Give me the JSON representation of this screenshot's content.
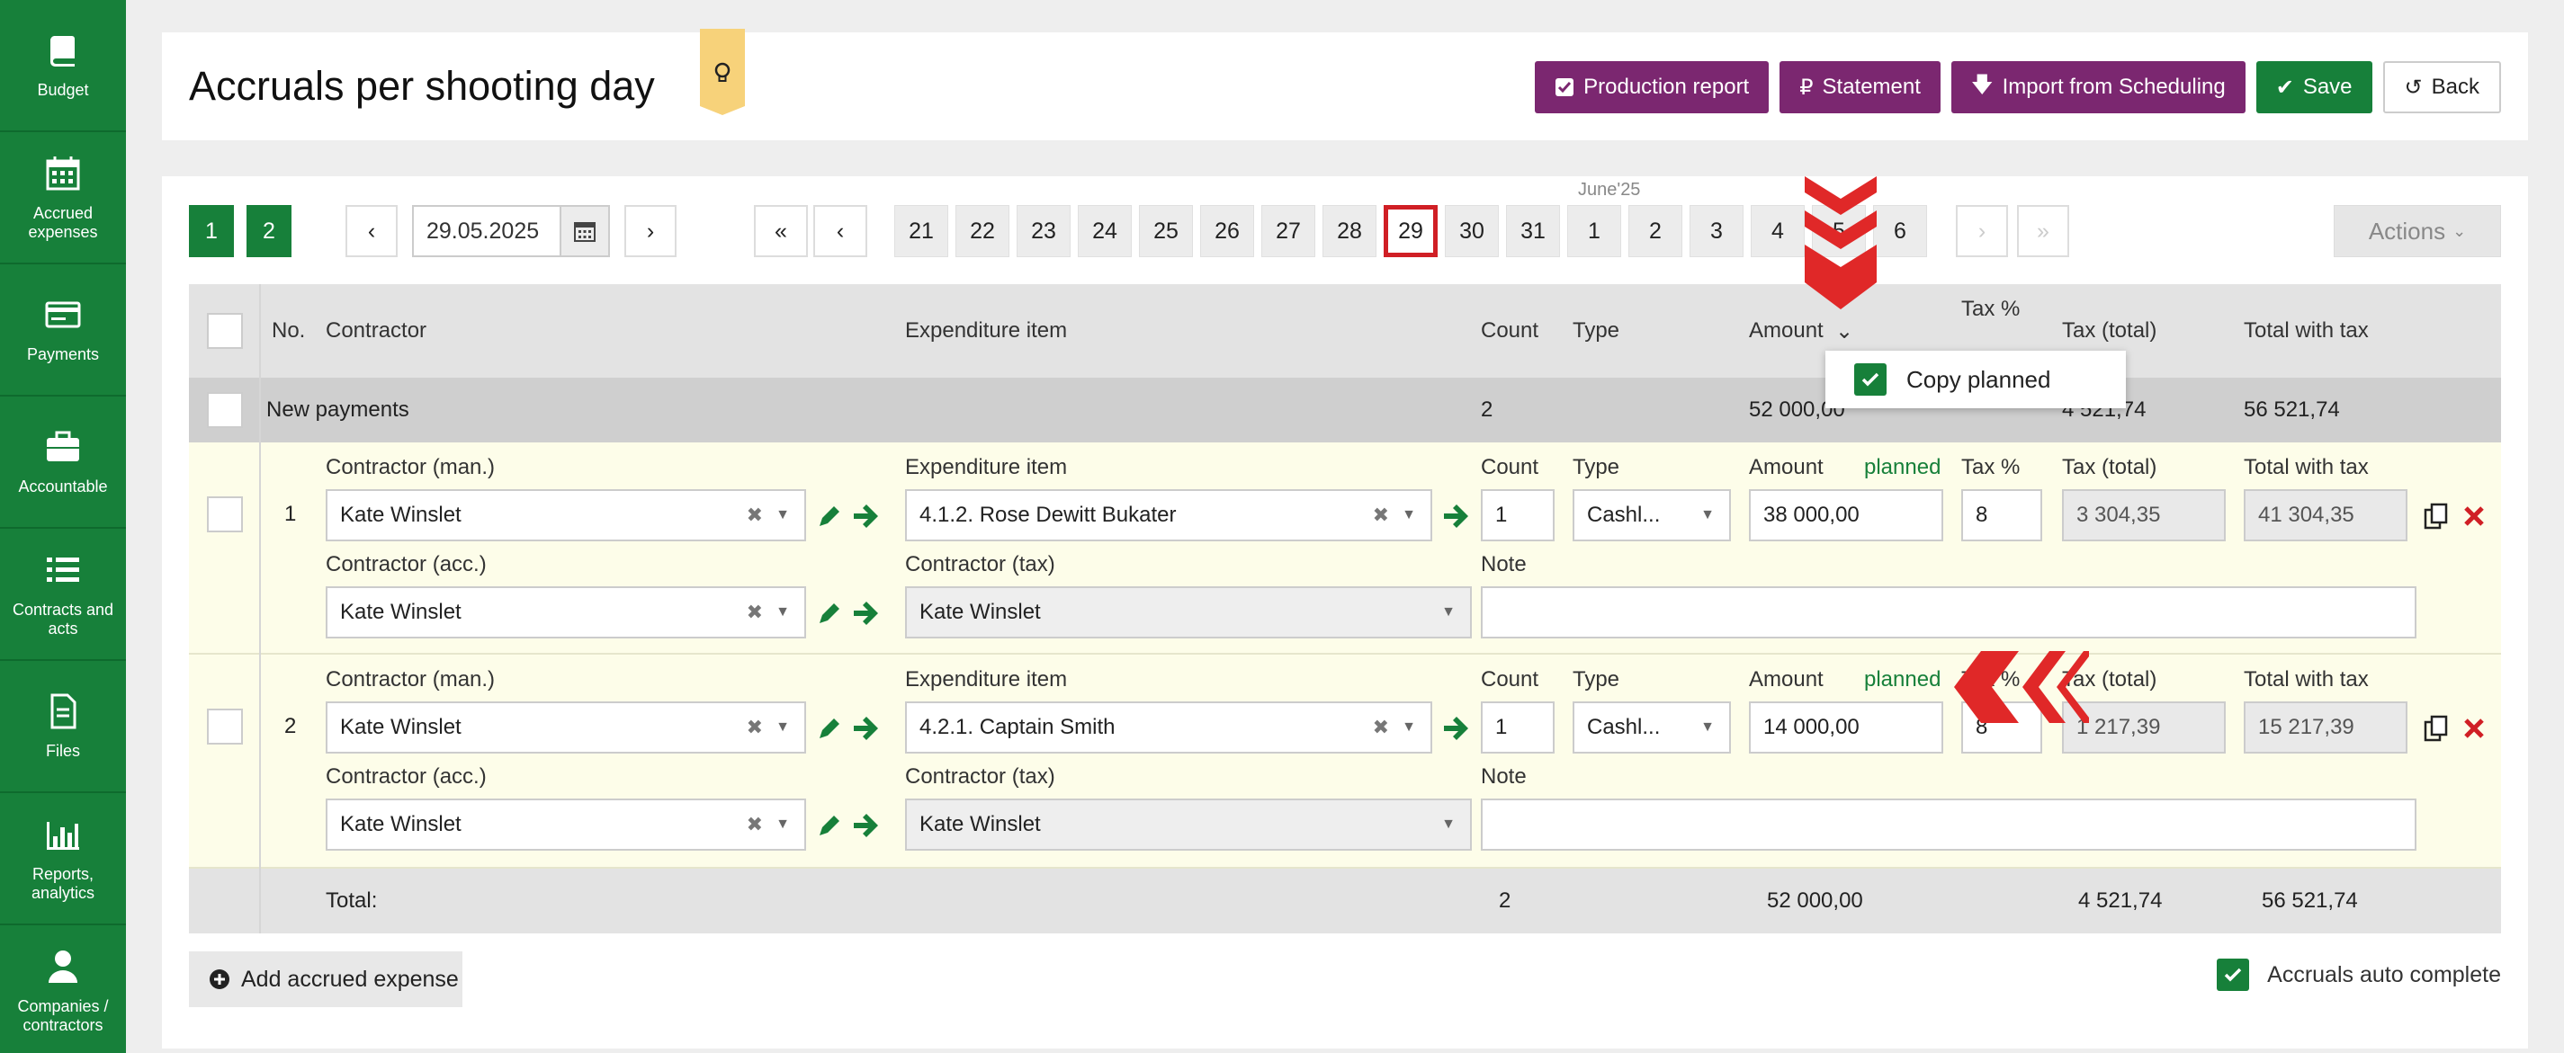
{
  "sidebar": {
    "items": [
      {
        "label": "Budget",
        "icon": "book-icon"
      },
      {
        "label": "Accrued expenses",
        "icon": "calendar-icon"
      },
      {
        "label": "Payments",
        "icon": "card-icon"
      },
      {
        "label": "Accountable",
        "icon": "briefcase-icon"
      },
      {
        "label": "Contracts and acts",
        "icon": "list-icon"
      },
      {
        "label": "Files",
        "icon": "file-icon"
      },
      {
        "label": "Reports, analytics",
        "icon": "chart-icon"
      },
      {
        "label": "Companies / contractors",
        "icon": "user-icon"
      }
    ]
  },
  "header": {
    "title": "Accruals per shooting day",
    "buttons": {
      "production_report": "Production report",
      "statement": "Statement",
      "import": "Import from Scheduling",
      "save": "Save",
      "back": "Back"
    }
  },
  "pager": {
    "pages": [
      "1",
      "2"
    ],
    "active_page": "2",
    "prev": "‹",
    "next": "›",
    "date": "29.05.2025",
    "first": "«",
    "last": "»",
    "days": [
      "21",
      "22",
      "23",
      "24",
      "25",
      "26",
      "27",
      "28",
      "29",
      "30",
      "31",
      "1",
      "2",
      "3",
      "4",
      "5",
      "6"
    ],
    "active_day": "29",
    "month_label": "June'25",
    "actions_label": "Actions"
  },
  "table": {
    "headers": {
      "no": "No.",
      "contractor": "Contractor",
      "expenditure": "Expenditure item",
      "count": "Count",
      "type": "Type",
      "amount": "Amount",
      "tax_pct": "Tax %",
      "tax_total": "Tax (total)",
      "total_with_tax": "Total with tax"
    },
    "group": {
      "label": "New payments",
      "count": "2",
      "amount": "52 000,00",
      "tax_total": "4 521,74",
      "total_with_tax": "56 521,74"
    },
    "field_labels": {
      "contractor_man": "Contractor (man.)",
      "contractor_acc": "Contractor (acc.)",
      "expenditure": "Expenditure item",
      "contractor_tax": "Contractor (tax)",
      "count": "Count",
      "type": "Type",
      "amount": "Amount",
      "planned": "planned",
      "tax_pct": "Tax %",
      "tax_total": "Tax (total)",
      "total_with_tax": "Total with tax",
      "note": "Note"
    },
    "rows": [
      {
        "no": "1",
        "contractor_man": "Kate Winslet",
        "contractor_acc": "Kate Winslet",
        "expenditure": "4.1.2. Rose Dewitt Bukater",
        "contractor_tax": "Kate Winslet",
        "count": "1",
        "type": "Cashl...",
        "amount": "38 000,00",
        "tax_pct": "8",
        "tax_total": "3 304,35",
        "total_with_tax": "41 304,35",
        "note": ""
      },
      {
        "no": "2",
        "contractor_man": "Kate Winslet",
        "contractor_acc": "Kate Winslet",
        "expenditure": "4.2.1. Captain Smith",
        "contractor_tax": "Kate Winslet",
        "count": "1",
        "type": "Cashl...",
        "amount": "14 000,00",
        "tax_pct": "8",
        "tax_total": "1 217,39",
        "total_with_tax": "15 217,39",
        "note": ""
      }
    ],
    "totals": {
      "label": "Total:",
      "count": "2",
      "amount": "52 000,00",
      "tax_total": "4 521,74",
      "total_with_tax": "56 521,74"
    }
  },
  "dropdown": {
    "copy_planned": "Copy planned"
  },
  "footer": {
    "add_button": "Add accrued expense",
    "auto_complete": "Accruals auto complete"
  },
  "colors": {
    "brand_green": "#17803a",
    "purple": "#7b2770",
    "annotation_red": "#e02828",
    "row_bg": "#fdfde9"
  }
}
